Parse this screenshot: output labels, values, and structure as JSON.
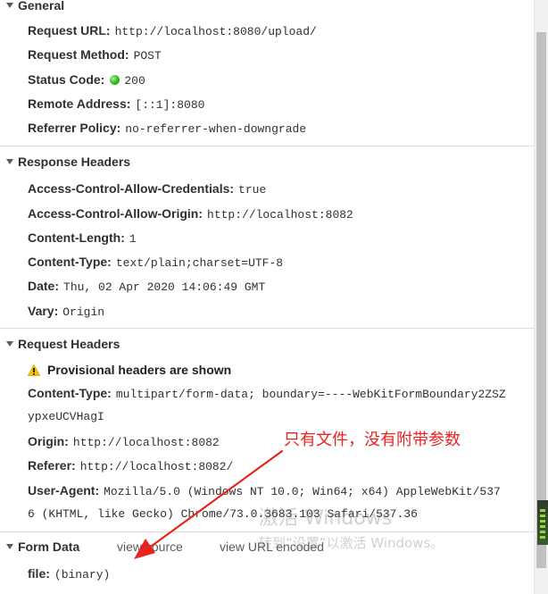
{
  "general": {
    "title": "General",
    "request_url": {
      "key": "Request URL:",
      "value": "http://localhost:8080/upload/"
    },
    "request_method": {
      "key": "Request Method:",
      "value": "POST"
    },
    "status_code": {
      "key": "Status Code:",
      "value": "200",
      "status_color": "#31b81c"
    },
    "remote_address": {
      "key": "Remote Address:",
      "value": "[::1]:8080"
    },
    "referrer_policy": {
      "key": "Referrer Policy:",
      "value": "no-referrer-when-downgrade"
    }
  },
  "response_headers": {
    "title": "Response Headers",
    "rows": [
      {
        "key": "Access-Control-Allow-Credentials:",
        "value": "true"
      },
      {
        "key": "Access-Control-Allow-Origin:",
        "value": "http://localhost:8082"
      },
      {
        "key": "Content-Length:",
        "value": "1"
      },
      {
        "key": "Content-Type:",
        "value": "text/plain;charset=UTF-8"
      },
      {
        "key": "Date:",
        "value": "Thu, 02 Apr 2020 14:06:49 GMT"
      },
      {
        "key": "Vary:",
        "value": "Origin"
      }
    ]
  },
  "request_headers": {
    "title": "Request Headers",
    "provisional_warning": "Provisional headers are shown",
    "content_type": {
      "key": "Content-Type:",
      "value": "multipart/form-data; boundary=----WebKitFormBoundary2ZSZ",
      "continuation": "ypxeUCVHagI"
    },
    "origin": {
      "key": "Origin:",
      "value": "http://localhost:8082"
    },
    "referer": {
      "key": "Referer:",
      "value": "http://localhost:8082/"
    },
    "user_agent": {
      "key": "User-Agent:",
      "value": "Mozilla/5.0 (Windows NT 10.0; Win64; x64) AppleWebKit/537",
      "continuation": "6 (KHTML, like Gecko) Chrome/73.0.3683.103 Safari/537.36"
    }
  },
  "form_data": {
    "title": "Form Data",
    "view_source_label": "view source",
    "view_url_encoded_label": "view URL encoded",
    "file": {
      "key": "file:",
      "value": "(binary)"
    }
  },
  "annotation": {
    "text": "只有文件，没有附带参数",
    "color": "#e8231e"
  },
  "watermark": {
    "line1": "激活 Windows",
    "line2": "转到“设置”以激活 Windows。"
  }
}
